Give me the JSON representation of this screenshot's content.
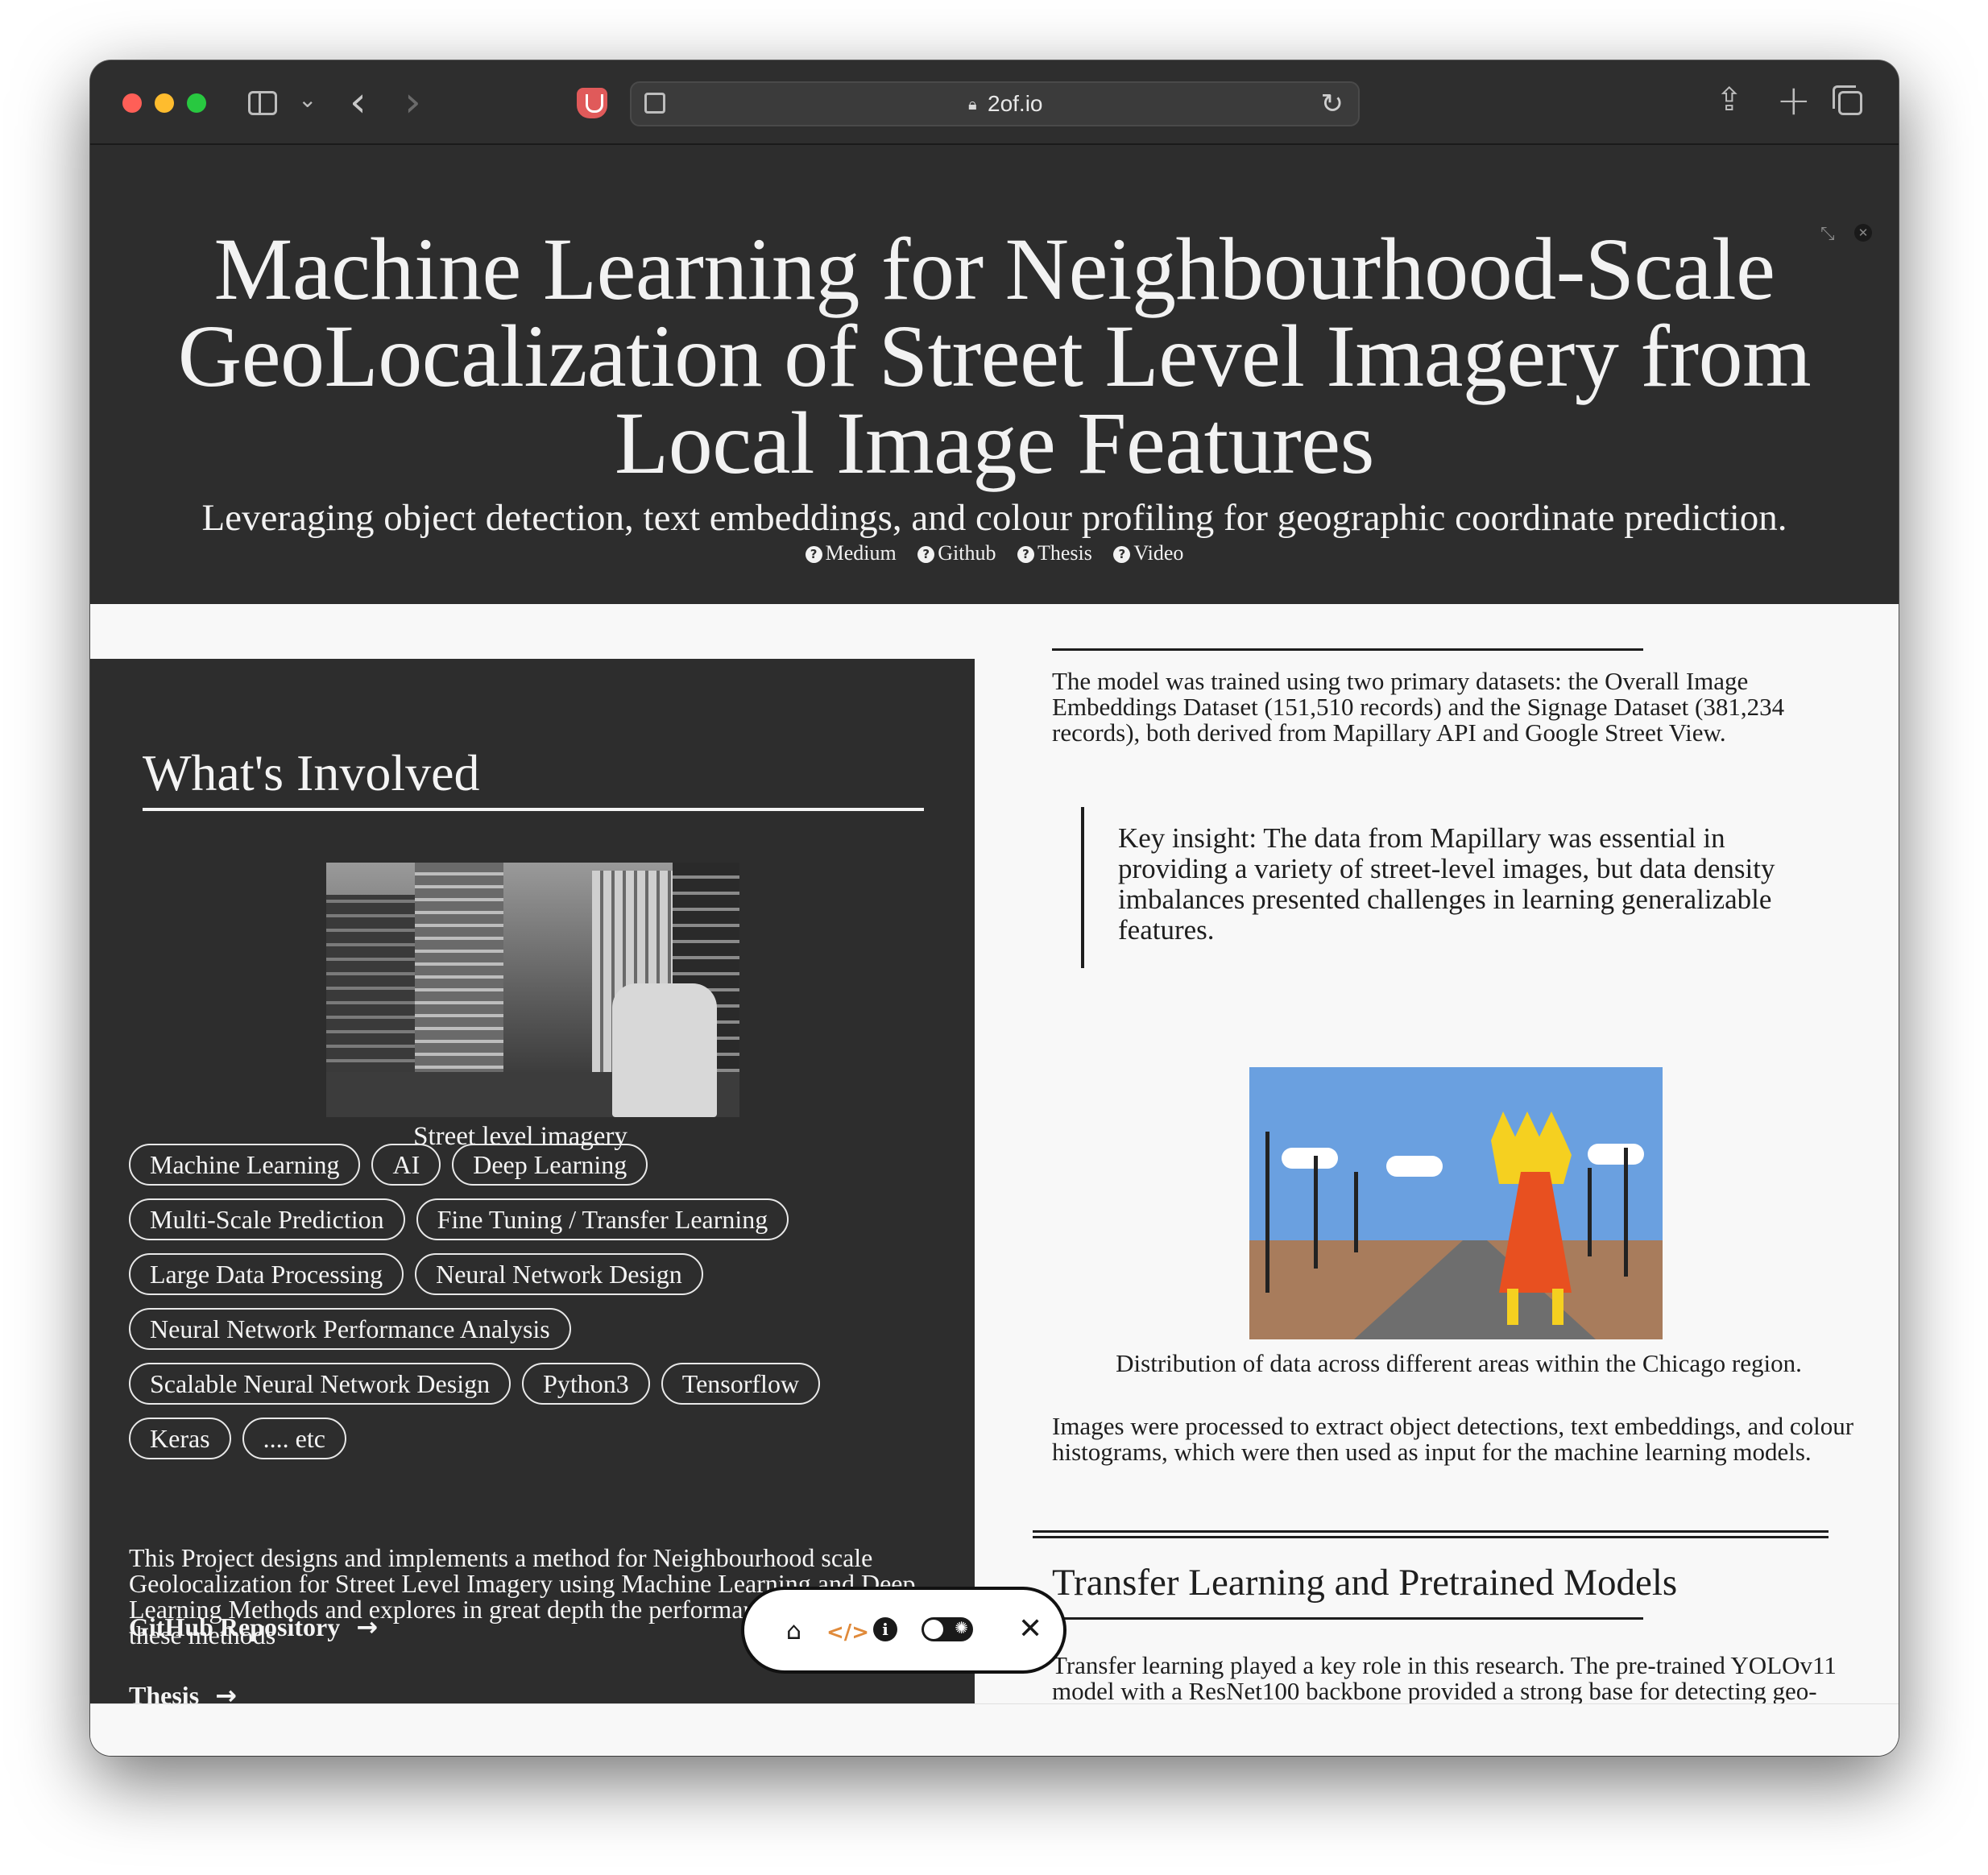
{
  "browser": {
    "url": "2of.io"
  },
  "hero": {
    "title": "Machine Learning for Neighbourhood-Scale GeoLocalization of Street Level Imagery from Local Image Features",
    "subtitle": "Leveraging object detection, text embeddings, and colour profiling for geographic coordinate prediction.",
    "links": [
      "Medium",
      "Github",
      "Thesis",
      "Video"
    ]
  },
  "left": {
    "heading": "What's Involved",
    "image_caption": "Street level imagery",
    "tags": [
      [
        "Machine Learning",
        "AI",
        "Deep Learning"
      ],
      [
        "Multi-Scale Prediction",
        "Fine Tuning / Transfer Learning"
      ],
      [
        "Large Data Processing",
        "Neural Network Design"
      ],
      [
        "Neural Network Performance Analysis"
      ],
      [
        "Scalable Neural Network Design",
        "Python3",
        "Tensorflow"
      ],
      [
        "Keras",
        ".... etc"
      ]
    ],
    "description": "This Project designs and implements a method for Neighbourhood scale Geolocalization for Street Level Imagery using Machine Learning and Deep Learning Methods and explores in great depth the performance and learning of these methods",
    "github_link": "GitHub Repository",
    "thesis_link": "Thesis"
  },
  "right": {
    "paragraph1": "The model was trained using two primary datasets: the Overall Image Embeddings Dataset (151,510 records) and the Signage Dataset (381,234 records), both derived from Mapillary API and Google Street View.",
    "quote": "Key insight: The data from Mapillary was essential in providing a variety of street-level images, but data density imbalances presented challenges in learning generalizable features.",
    "image_caption": "Distribution of data across different areas within the Chicago region.",
    "paragraph2": "Images were processed to extract object detections, text embeddings, and colour histograms, which were then used as input for the machine learning models.",
    "heading2": "Transfer Learning and Pretrained Models",
    "paragraph3": "Transfer learning played a key role in this research. The pre-trained YOLOv11 model with a ResNet100 backbone provided a strong base for detecting geo-informative objects."
  },
  "icons": {
    "arrow": "→",
    "close": "✕",
    "back": "‹",
    "forward": "›"
  }
}
